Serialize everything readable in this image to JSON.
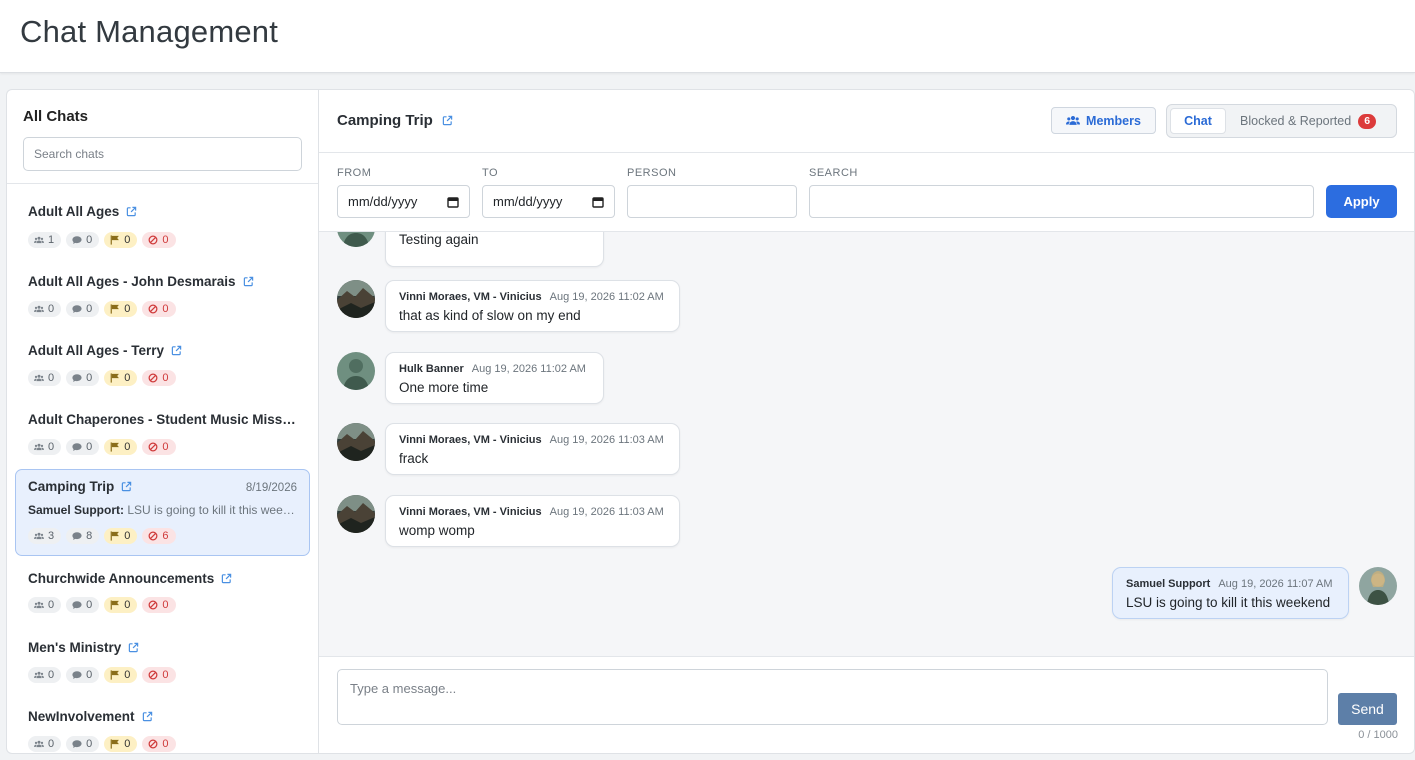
{
  "page": {
    "title": "Chat Management"
  },
  "sidebar": {
    "title": "All Chats",
    "search_placeholder": "Search chats",
    "chats": [
      {
        "name": "Adult All Ages",
        "members": "1",
        "messages": "0",
        "flags": "0",
        "blocked": "0"
      },
      {
        "name": "Adult All Ages - John Desmarais",
        "members": "0",
        "messages": "0",
        "flags": "0",
        "blocked": "0"
      },
      {
        "name": "Adult All Ages - Terry",
        "members": "0",
        "messages": "0",
        "flags": "0",
        "blocked": "0"
      },
      {
        "name": "Adult Chaperones - Student Music Mission",
        "members": "0",
        "messages": "0",
        "flags": "0",
        "blocked": "0"
      },
      {
        "name": "Camping Trip",
        "date": "8/19/2026",
        "preview_sender": "Samuel Support:",
        "preview_text": "LSU is going to kill it this weekend",
        "members": "3",
        "messages": "8",
        "flags": "0",
        "blocked": "6",
        "active": true
      },
      {
        "name": "Churchwide Announcements",
        "members": "0",
        "messages": "0",
        "flags": "0",
        "blocked": "0"
      },
      {
        "name": "Men's Ministry",
        "members": "0",
        "messages": "0",
        "flags": "0",
        "blocked": "0"
      },
      {
        "name": "NewInvolvement",
        "members": "0",
        "messages": "0",
        "flags": "0",
        "blocked": "0"
      }
    ]
  },
  "main": {
    "chat_title": "Camping Trip",
    "members_button": "Members",
    "tabs": [
      {
        "label": "Chat",
        "active": true
      },
      {
        "label": "Blocked & Reported",
        "count": "6"
      }
    ],
    "filters": {
      "from_label": "FROM",
      "from_value": "mm/dd/yyyy",
      "to_label": "TO",
      "to_value": "mm/dd/yyyy",
      "person_label": "PERSON",
      "person_value": "",
      "search_label": "SEARCH",
      "search_value": "",
      "apply_label": "Apply"
    },
    "messages": [
      {
        "sender": "",
        "time": "",
        "text": "Testing again",
        "avatar": "hulk"
      },
      {
        "sender": "Vinni Moraes, VM - Vinicius",
        "time": "Aug 19, 2026 11:02 AM",
        "text": "that as kind of slow on my end",
        "avatar": "landscape"
      },
      {
        "sender": "Hulk Banner",
        "time": "Aug 19, 2026 11:02 AM",
        "text": "One more time",
        "avatar": "hulk"
      },
      {
        "sender": "Vinni Moraes, VM - Vinicius",
        "time": "Aug 19, 2026 11:03 AM",
        "text": "frack",
        "avatar": "landscape"
      },
      {
        "sender": "Vinni Moraes, VM - Vinicius",
        "time": "Aug 19, 2026 11:03 AM",
        "text": "womp womp",
        "avatar": "landscape"
      },
      {
        "sender": "Samuel Support",
        "time": "Aug 19, 2026 11:07 AM",
        "text": "LSU is going to kill it this weekend",
        "avatar": "person",
        "self": true
      }
    ],
    "composer": {
      "placeholder": "Type a message...",
      "send_label": "Send",
      "char_count": "0 / 1000"
    }
  },
  "colors": {
    "accent": "#2c6de0",
    "send_button": "#5d7fa8",
    "danger_badge": "#dc3b3b",
    "flag_badge_bg": "#fdf0c4",
    "active_chat_bg": "#e8f0fd"
  },
  "icons": {
    "external_link": "external-link-icon",
    "members": "users-icon",
    "messages": "comment-icon",
    "flags": "flag-icon",
    "blocked": "ban-icon",
    "calendar": "calendar-icon"
  }
}
